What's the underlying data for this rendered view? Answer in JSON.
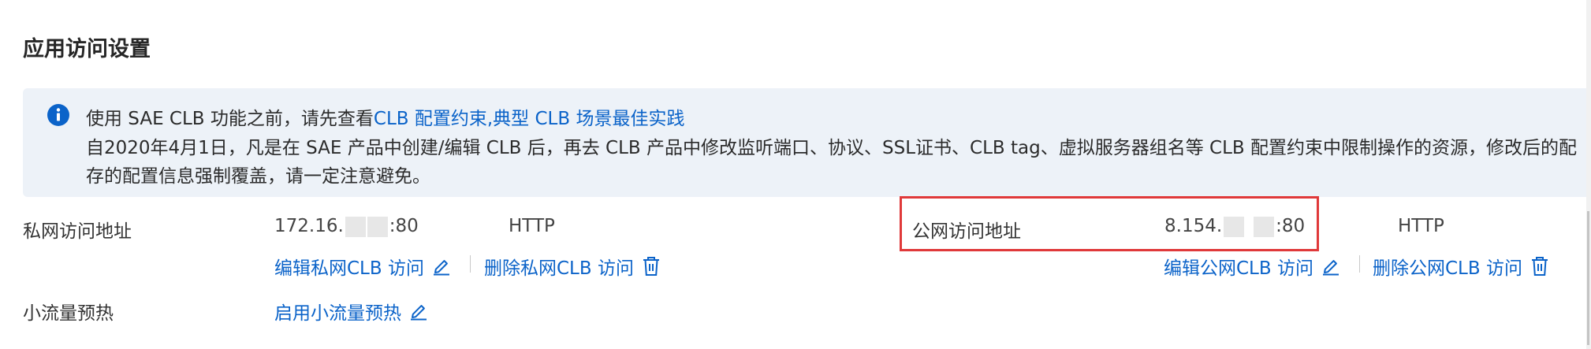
{
  "section": {
    "title": "应用访问设置"
  },
  "notice": {
    "line1_prefix": "使用 SAE CLB 功能之前，请先查看",
    "link_constraints": "CLB 配置约束",
    "separator": ",",
    "link_best_practice": "典型 CLB 场景最佳实践",
    "line2": "自2020年4月1日，凡是在 SAE 产品中创建/编辑 CLB 后，再去 CLB 产品中修改监听端口、协议、SSL证书、CLB tag、虚拟服务器组名等 CLB 配置约束中限制操作的资源，修改后的配",
    "line3": "存的配置信息强制覆盖，请一定注意避免。",
    "icon": "info-icon",
    "icon_color": "#0b63c9"
  },
  "private_access": {
    "label": "私网访问地址",
    "address_prefix": "172.16.",
    "address_suffix": ":80",
    "protocol": "HTTP",
    "edit_label": "编辑私网CLB 访问",
    "delete_label": "删除私网CLB 访问"
  },
  "public_access": {
    "label": "公网访问地址",
    "address_prefix": "8.154.",
    "address_suffix": ":80",
    "protocol": "HTTP",
    "edit_label": "编辑公网CLB 访问",
    "delete_label": "删除公网CLB 访问"
  },
  "warmup": {
    "label": "小流量预热",
    "enable_label": "启用小流量预热"
  },
  "colors": {
    "link": "#0b63c9",
    "highlight": "#e0393a",
    "notice_bg": "#edf2f8"
  }
}
